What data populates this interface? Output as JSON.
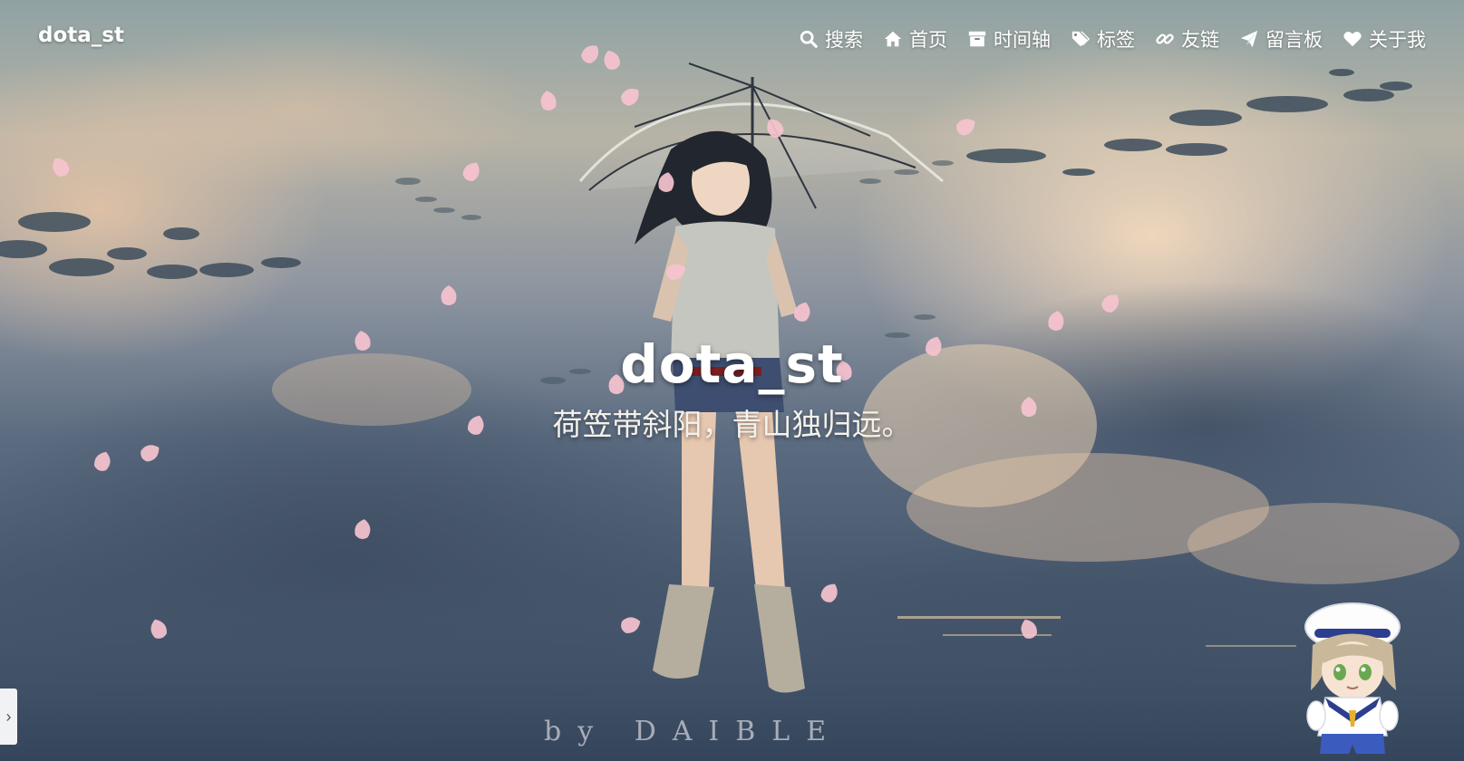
{
  "header": {
    "brand": "dota_st",
    "nav": [
      {
        "label": "搜索",
        "icon": "search-icon"
      },
      {
        "label": "首页",
        "icon": "home-icon"
      },
      {
        "label": "时间轴",
        "icon": "archive-icon"
      },
      {
        "label": "标签",
        "icon": "tags-icon"
      },
      {
        "label": "友链",
        "icon": "link-icon"
      },
      {
        "label": "留言板",
        "icon": "paper-plane-icon"
      },
      {
        "label": "关于我",
        "icon": "heart-icon"
      }
    ]
  },
  "hero": {
    "title": "dota_st",
    "subtitle": "荷笠带斜阳，青山独归远。"
  },
  "background": {
    "signature": "by DAIBLE",
    "icons": [
      "anime-girl-with-umbrella-illustration",
      "cloudscape",
      "flying-fish",
      "sakura-petal"
    ]
  },
  "widgets": {
    "side_toggle": "chevron-right-icon",
    "mascot": "sailor-boy-mascot"
  },
  "colors": {
    "text": "#ffffff",
    "petal": "#f6c3cf",
    "sky_top": "#8fa2a4",
    "sky_bottom": "#3b4c61",
    "cloud_light": "#e8cdb0"
  }
}
